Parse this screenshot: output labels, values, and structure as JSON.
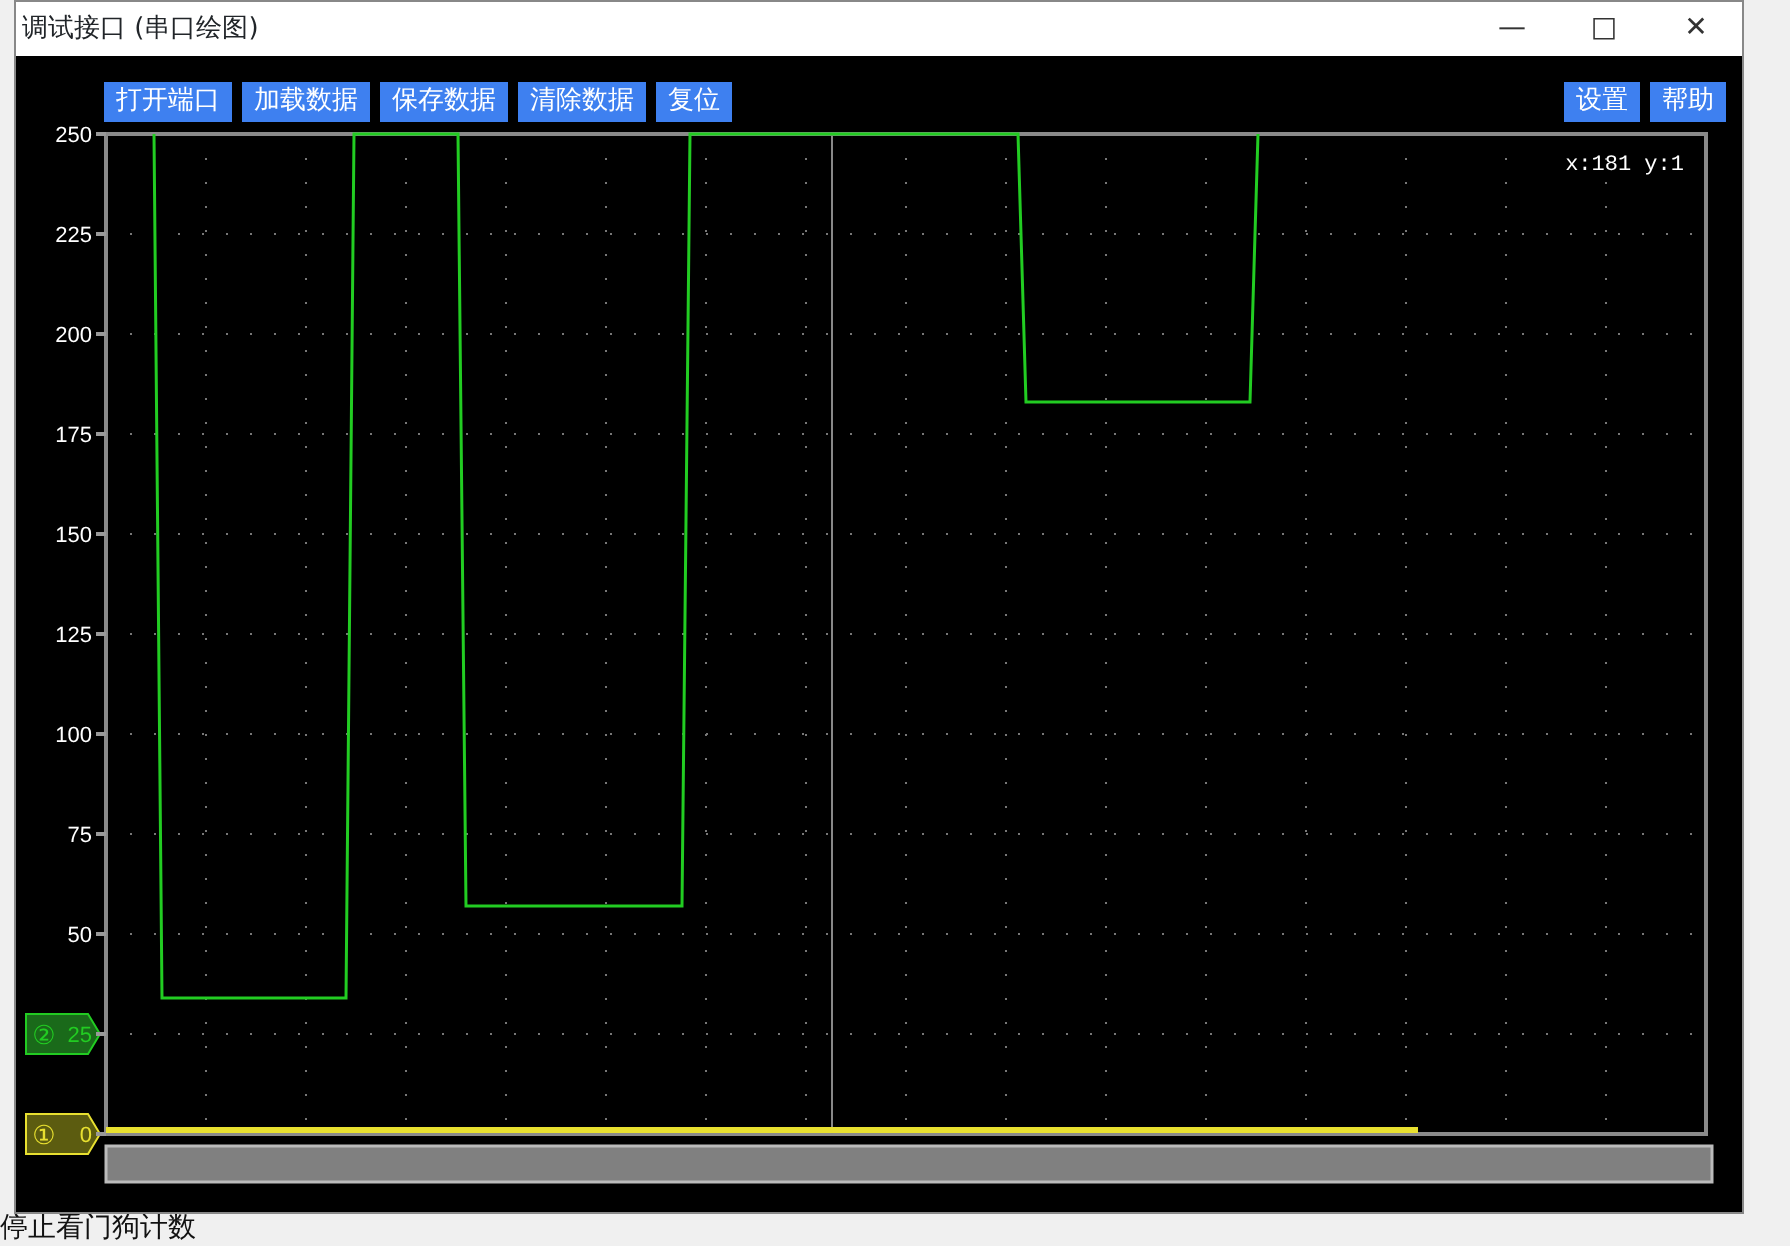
{
  "window": {
    "title": "调试接口 (串口绘图)",
    "controls": [
      "—",
      "□",
      "✕"
    ]
  },
  "toolbar": {
    "left_buttons": [
      "打开端口",
      "加载数据",
      "保存数据",
      "清除数据",
      "复位"
    ],
    "right_buttons": [
      "设置",
      "帮助"
    ]
  },
  "cursor_readout": "x:181 y:1",
  "channel_tags": [
    {
      "color": "#1a6a1a"
    },
    {
      "color": "#5c5c10"
    }
  ],
  "chart_data": {
    "type": "line",
    "grid": true,
    "ylim": [
      0,
      250
    ],
    "yticks": [
      0,
      25,
      50,
      75,
      100,
      125,
      150,
      175,
      200,
      225,
      250
    ],
    "categories": [
      null,
      null,
      null,
      null,
      null,
      null,
      null,
      null,
      null,
      null,
      null,
      null,
      null,
      null,
      null,
      null,
      null,
      null,
      null,
      null,
      null,
      null,
      null,
      null,
      null,
      null,
      null,
      null,
      null,
      null,
      null,
      null,
      null,
      null,
      null,
      null,
      null,
      null,
      null,
      null,
      null,
      null,
      null,
      null,
      null,
      null,
      null,
      null,
      null,
      null,
      null,
      null,
      null,
      null,
      null,
      null,
      null,
      null,
      null,
      null,
      null,
      null,
      null,
      null,
      null,
      null,
      null,
      null,
      null,
      null,
      null,
      null,
      null,
      null,
      null,
      null,
      null,
      null,
      null,
      null,
      null,
      null,
      null,
      null,
      null,
      null,
      null,
      null,
      null,
      null,
      null,
      null,
      null,
      null,
      null,
      null,
      null,
      null,
      null,
      null,
      null,
      null,
      null,
      null,
      null,
      null,
      null,
      null,
      null,
      null,
      null,
      null,
      null,
      null,
      null,
      null,
      null,
      null,
      null,
      null,
      null,
      null,
      null,
      null,
      null,
      null,
      null,
      null,
      null,
      null,
      null,
      null,
      null,
      null,
      null,
      null,
      null,
      null,
      null,
      null,
      null,
      null,
      null,
      null,
      null,
      null,
      null,
      null,
      null,
      null,
      null,
      null,
      null,
      null,
      null,
      null,
      null,
      null,
      null,
      null,
      null,
      null,
      null,
      null,
      null
    ],
    "series": [
      {
        "name": "②",
        "color": "#22cc22",
        "values": [
          null,
          null,
          null,
          null,
          null,
          null,
          250,
          34,
          34,
          34,
          34,
          34,
          34,
          34,
          34,
          34,
          34,
          34,
          34,
          34,
          34,
          34,
          34,
          34,
          34,
          34,
          34,
          34,
          34,
          34,
          34,
          250,
          250,
          250,
          250,
          250,
          250,
          250,
          250,
          250,
          250,
          250,
          250,
          250,
          250,
          57,
          57,
          57,
          57,
          57,
          57,
          57,
          57,
          57,
          57,
          57,
          57,
          57,
          57,
          57,
          57,
          57,
          57,
          57,
          57,
          57,
          57,
          57,
          57,
          57,
          57,
          57,
          57,
          250,
          250,
          250,
          250,
          250,
          250,
          250,
          250,
          250,
          250,
          250,
          250,
          250,
          250,
          250,
          250,
          250,
          250,
          250,
          250,
          250,
          250,
          250,
          250,
          250,
          250,
          250,
          250,
          250,
          250,
          250,
          250,
          250,
          250,
          250,
          250,
          250,
          250,
          250,
          250,
          250,
          250,
          183,
          183,
          183,
          183,
          183,
          183,
          183,
          183,
          183,
          183,
          183,
          183,
          183,
          183,
          183,
          183,
          183,
          183,
          183,
          183,
          183,
          183,
          183,
          183,
          183,
          183,
          183,
          183,
          183,
          250,
          null,
          null,
          null,
          null,
          null,
          null,
          null,
          null,
          null,
          null,
          null,
          null,
          null,
          null,
          null,
          null,
          null,
          null,
          null,
          null
        ]
      },
      {
        "name": "①",
        "color": "#e8e030",
        "values": [
          1,
          1,
          1,
          1,
          1,
          1,
          1,
          1,
          1,
          1,
          1,
          1,
          1,
          1,
          1,
          1,
          1,
          1,
          1,
          1,
          1,
          1,
          1,
          1,
          1,
          1,
          1,
          1,
          1,
          1,
          1,
          1,
          1,
          1,
          1,
          1,
          1,
          1,
          1,
          1,
          1,
          1,
          1,
          1,
          1,
          1,
          1,
          1,
          1,
          1,
          1,
          1,
          1,
          1,
          1,
          1,
          1,
          1,
          1,
          1,
          1,
          1,
          1,
          1,
          1,
          1,
          1,
          1,
          1,
          1,
          1,
          1,
          1,
          1,
          1,
          1,
          1,
          1,
          1,
          1,
          1,
          1,
          1,
          1,
          1,
          1,
          1,
          1,
          1,
          1,
          1,
          1,
          1,
          1,
          1,
          1,
          1,
          1,
          1,
          1,
          1,
          1,
          1,
          1,
          1,
          1,
          1,
          1,
          1,
          1,
          1,
          1,
          1,
          1,
          1,
          1,
          1,
          1,
          1,
          1,
          1,
          1,
          1,
          1,
          1,
          1,
          1,
          1,
          1,
          1,
          1,
          1,
          1,
          1,
          1,
          1,
          1,
          1,
          1,
          1,
          1,
          1,
          1,
          1,
          1,
          1,
          1,
          1,
          1,
          1,
          1,
          1,
          1,
          1,
          1,
          1,
          1,
          1,
          1,
          1,
          1,
          1,
          1,
          1,
          1
        ]
      }
    ]
  },
  "background_text": "停止看门狗计数"
}
